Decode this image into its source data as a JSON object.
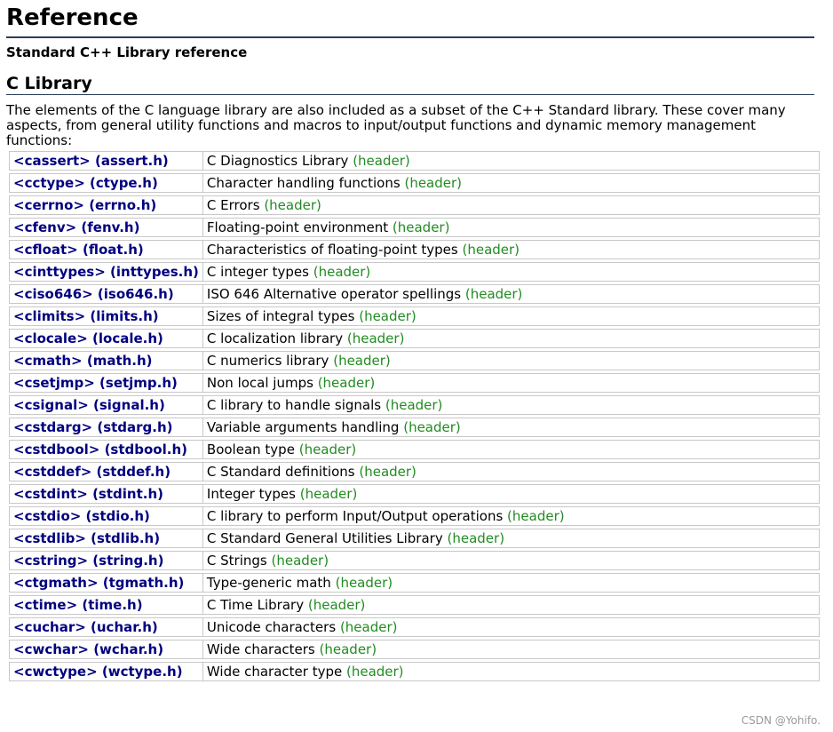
{
  "page": {
    "title": "Reference",
    "subtitle": "Standard C++ Library reference",
    "section_title": "C Library",
    "intro": "The elements of the C language library are also included as a subset of the C++ Standard library. These cover many aspects, from general utility functions and macros to input/output functions and dynamic memory management functions:"
  },
  "headers": [
    {
      "name": "<cassert> (assert.h)",
      "desc": "C Diagnostics Library",
      "tag": "(header)"
    },
    {
      "name": "<cctype> (ctype.h)",
      "desc": "Character handling functions",
      "tag": "(header)"
    },
    {
      "name": "<cerrno> (errno.h)",
      "desc": "C Errors",
      "tag": "(header)"
    },
    {
      "name": "<cfenv> (fenv.h)",
      "desc": "Floating-point environment",
      "tag": "(header)"
    },
    {
      "name": "<cfloat> (float.h)",
      "desc": "Characteristics of floating-point types",
      "tag": "(header)"
    },
    {
      "name": "<cinttypes> (inttypes.h)",
      "desc": "C integer types",
      "tag": "(header)"
    },
    {
      "name": "<ciso646> (iso646.h)",
      "desc": "ISO 646 Alternative operator spellings",
      "tag": "(header)"
    },
    {
      "name": "<climits> (limits.h)",
      "desc": "Sizes of integral types",
      "tag": "(header)"
    },
    {
      "name": "<clocale> (locale.h)",
      "desc": "C localization library",
      "tag": "(header)"
    },
    {
      "name": "<cmath> (math.h)",
      "desc": "C numerics library",
      "tag": "(header)"
    },
    {
      "name": "<csetjmp> (setjmp.h)",
      "desc": "Non local jumps",
      "tag": "(header)"
    },
    {
      "name": "<csignal> (signal.h)",
      "desc": "C library to handle signals",
      "tag": "(header)"
    },
    {
      "name": "<cstdarg> (stdarg.h)",
      "desc": "Variable arguments handling",
      "tag": "(header)"
    },
    {
      "name": "<cstdbool> (stdbool.h)",
      "desc": "Boolean type",
      "tag": "(header)"
    },
    {
      "name": "<cstddef> (stddef.h)",
      "desc": "C Standard definitions",
      "tag": "(header)"
    },
    {
      "name": "<cstdint> (stdint.h)",
      "desc": "Integer types",
      "tag": "(header)"
    },
    {
      "name": "<cstdio> (stdio.h)",
      "desc": "C library to perform Input/Output operations",
      "tag": "(header)"
    },
    {
      "name": "<cstdlib> (stdlib.h)",
      "desc": "C Standard General Utilities Library",
      "tag": "(header)"
    },
    {
      "name": "<cstring> (string.h)",
      "desc": "C Strings",
      "tag": "(header)"
    },
    {
      "name": "<ctgmath> (tgmath.h)",
      "desc": "Type-generic math",
      "tag": "(header)"
    },
    {
      "name": "<ctime> (time.h)",
      "desc": "C Time Library",
      "tag": "(header)"
    },
    {
      "name": "<cuchar> (uchar.h)",
      "desc": "Unicode characters",
      "tag": "(header)"
    },
    {
      "name": "<cwchar> (wchar.h)",
      "desc": "Wide characters",
      "tag": "(header)"
    },
    {
      "name": "<cwctype> (wctype.h)",
      "desc": "Wide character type",
      "tag": "(header)"
    }
  ],
  "watermark": "CSDN @Yohifo.",
  "colors": {
    "link": "#000080",
    "tag": "#228b22",
    "rule": "#2b3f5a",
    "cell_border": "#c8c8c8"
  }
}
